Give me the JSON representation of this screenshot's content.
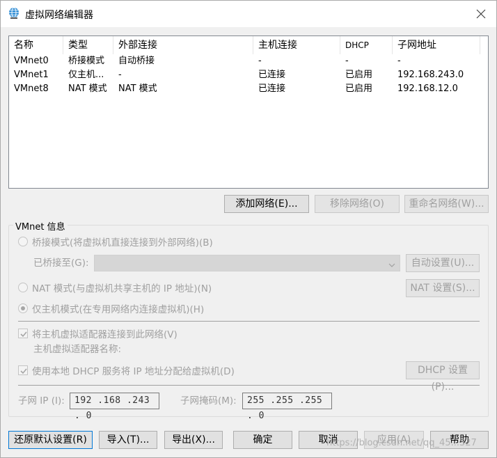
{
  "window": {
    "title": "虚拟网络编辑器"
  },
  "list": {
    "columns": [
      "名称",
      "类型",
      "外部连接",
      "主机连接",
      "DHCP",
      "子网地址"
    ],
    "rows": [
      [
        "VMnet0",
        "桥接模式",
        "自动桥接",
        "-",
        "-",
        "-"
      ],
      [
        "VMnet1",
        "仅主机...",
        "-",
        "已连接",
        "已启用",
        "192.168.243.0"
      ],
      [
        "VMnet8",
        "NAT 模式",
        "NAT 模式",
        "已连接",
        "已启用",
        "192.168.12.0"
      ]
    ]
  },
  "list_buttons": {
    "add": "添加网络(E)...",
    "remove": "移除网络(O)",
    "rename": "重命名网络(W)..."
  },
  "group": {
    "label": "VMnet 信息",
    "bridged_radio": "桥接模式(将虚拟机直接连接到外部网络)(B)",
    "bridged_to_label": "已桥接至(G):",
    "auto_settings": "自动设置(U)...",
    "nat_radio": "NAT 模式(与虚拟机共享主机的 IP 地址)(N)",
    "nat_settings": "NAT 设置(S)...",
    "hostonly_radio": "仅主机模式(在专用网络内连接虚拟机)(H)",
    "connect_adapter_check": "将主机虚拟适配器连接到此网络(V)",
    "adapter_name_label": "主机虚拟适配器名称:",
    "dhcp_check": "使用本地 DHCP 服务将 IP 地址分配给虚拟机(D)",
    "dhcp_settings": "DHCP 设置(P)...",
    "subnet_ip_label": "子网 IP (I):",
    "subnet_ip": "192 .168 .243 . 0",
    "subnet_mask_label": "子网掩码(M):",
    "subnet_mask": "255 .255 .255 . 0"
  },
  "footer": {
    "restore": "还原默认设置(R)",
    "import": "导入(T)...",
    "export": "导出(X)...",
    "ok": "确定",
    "cancel": "取消",
    "apply": "应用(A)",
    "help": "帮助"
  },
  "watermark": "https://blog.csdn.net/qq_45...327",
  "colors": {
    "accent": "#0078d7",
    "disabled_text": "#a0a0a0",
    "button_bg": "#e1e1e1"
  },
  "icons": {
    "app": "globe-network-icon",
    "close": "close-icon"
  }
}
